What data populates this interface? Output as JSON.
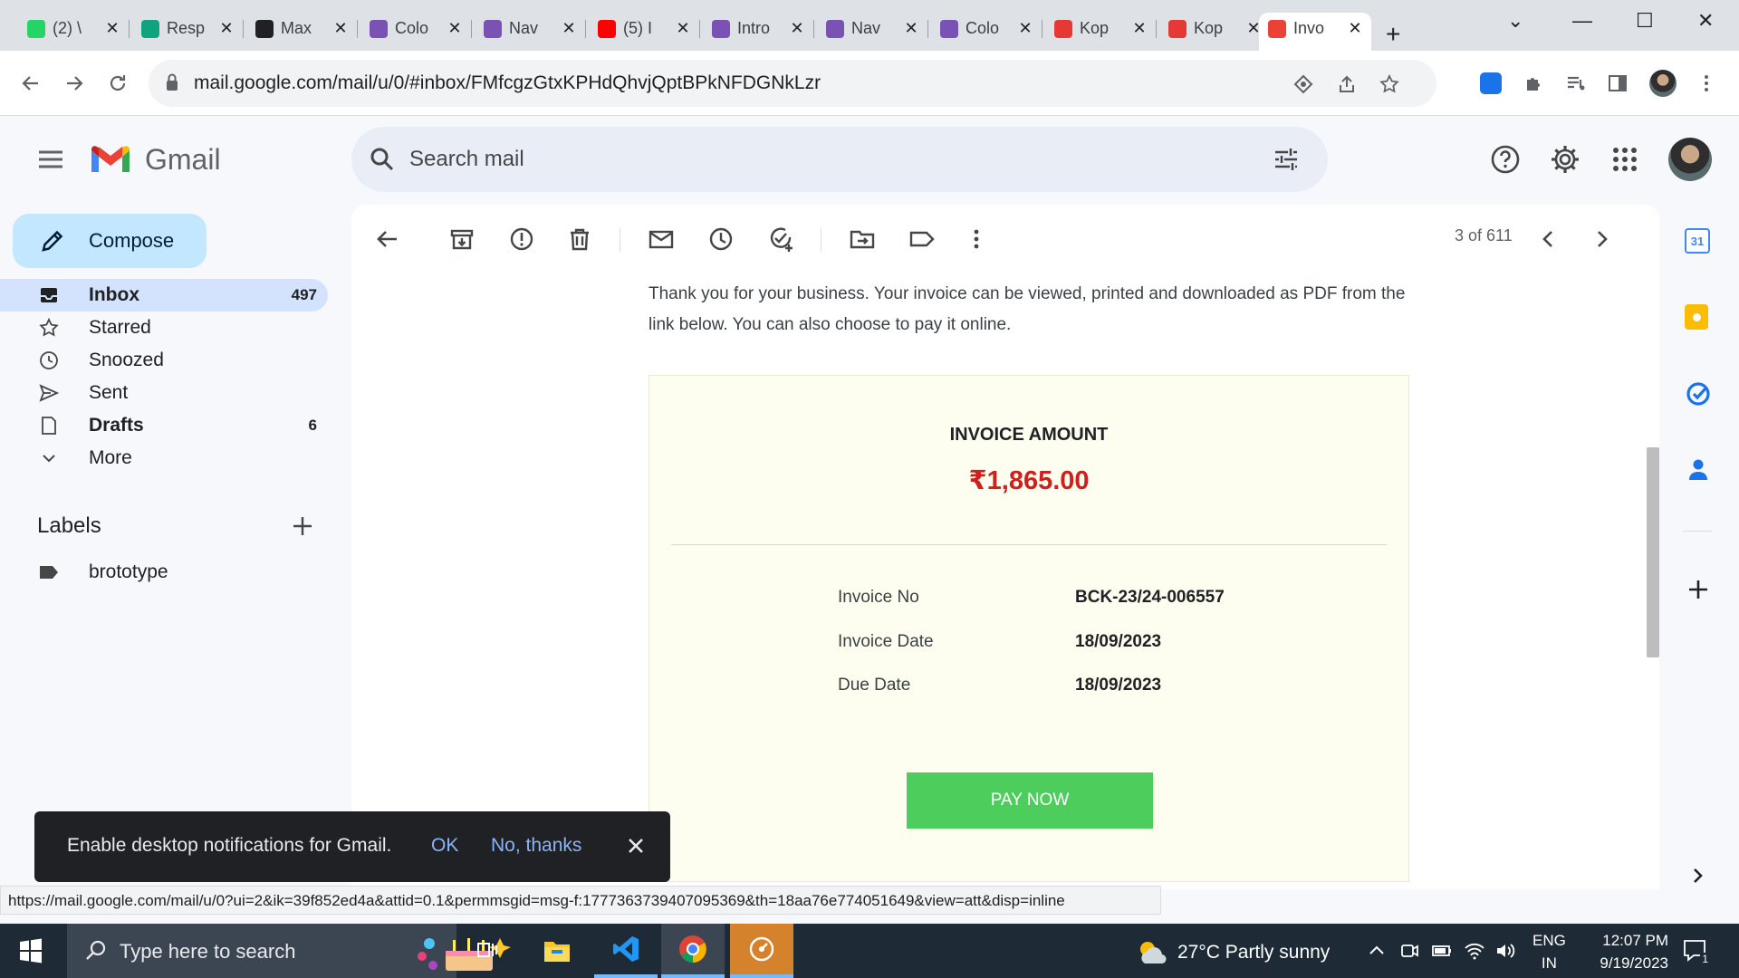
{
  "browser": {
    "tabs": [
      {
        "label": "(2) \\",
        "icon": "whatsapp-icon",
        "color": "#25d366"
      },
      {
        "label": "Resp",
        "icon": "chatgpt-icon",
        "color": "#10a37f"
      },
      {
        "label": "Max",
        "icon": "max-icon",
        "color": "#202124"
      },
      {
        "label": "Colo",
        "icon": "bootstrap-icon",
        "color": "#7952b3"
      },
      {
        "label": "Nav",
        "icon": "bootstrap-icon",
        "color": "#7952b3"
      },
      {
        "label": "(5) I",
        "icon": "youtube-icon",
        "color": "#ff0000"
      },
      {
        "label": "Intro",
        "icon": "bootstrap-icon",
        "color": "#7952b3"
      },
      {
        "label": "Nav",
        "icon": "bootstrap-icon",
        "color": "#7952b3"
      },
      {
        "label": "Colo",
        "icon": "bootstrap-icon",
        "color": "#7952b3"
      },
      {
        "label": "Kop",
        "icon": "koparo-icon",
        "color": "#e53935"
      },
      {
        "label": "Kop",
        "icon": "koparo-icon",
        "color": "#e53935"
      },
      {
        "label": "Invo",
        "icon": "gmail-icon",
        "color": "#ea4335",
        "active": true
      }
    ],
    "url": "mail.google.com/mail/u/0/#inbox/FMfcgzGtxKPHdQhvjQptBPkNFDGNkLzr"
  },
  "gmail": {
    "wordmark": "Gmail",
    "search_placeholder": "Search mail",
    "compose_label": "Compose",
    "nav": [
      {
        "label": "Inbox",
        "count": "497",
        "icon": "inbox-icon"
      },
      {
        "label": "Starred",
        "count": "",
        "icon": "star-icon"
      },
      {
        "label": "Snoozed",
        "count": "",
        "icon": "clock-icon"
      },
      {
        "label": "Sent",
        "count": "",
        "icon": "send-icon"
      },
      {
        "label": "Drafts",
        "count": "6",
        "icon": "draft-icon"
      },
      {
        "label": "More",
        "count": "",
        "icon": "chevron-down-icon"
      }
    ],
    "labels_title": "Labels",
    "labels": [
      {
        "label": "brototype",
        "icon": "label-icon"
      }
    ],
    "pager": "3 of 611",
    "accent": "#c2e7ff"
  },
  "email": {
    "message": "Thank you for your business. Your invoice can be viewed, printed and downloaded as PDF from the link below. You can also choose to pay it online.",
    "invoice_title": "INVOICE AMOUNT",
    "invoice_amount": "₹1,865.00",
    "rows": [
      {
        "label": "Invoice No",
        "value": "BCK-23/24-006557"
      },
      {
        "label": "Invoice Date",
        "value": "18/09/2023"
      },
      {
        "label": "Due Date",
        "value": "18/09/2023"
      }
    ],
    "pay_label": "PAY NOW",
    "pay_color": "#4ccd5c",
    "amount_color": "#d0201c"
  },
  "toast": {
    "text": "Enable desktop notifications for Gmail.",
    "ok": "OK",
    "no": "No, thanks"
  },
  "status_url": "https://mail.google.com/mail/u/0?ui=2&ik=39f852ed4a&attid=0.1&permmsgid=msg-f:1777363739407095369&th=18aa76e774051649&view=att&disp=inline",
  "taskbar": {
    "search_placeholder": "Type here to search",
    "weather": "27°C  Partly sunny",
    "lang_top": "ENG",
    "lang_bottom": "IN",
    "time": "12:07 PM",
    "date": "9/19/2023",
    "notif_count": "1"
  }
}
